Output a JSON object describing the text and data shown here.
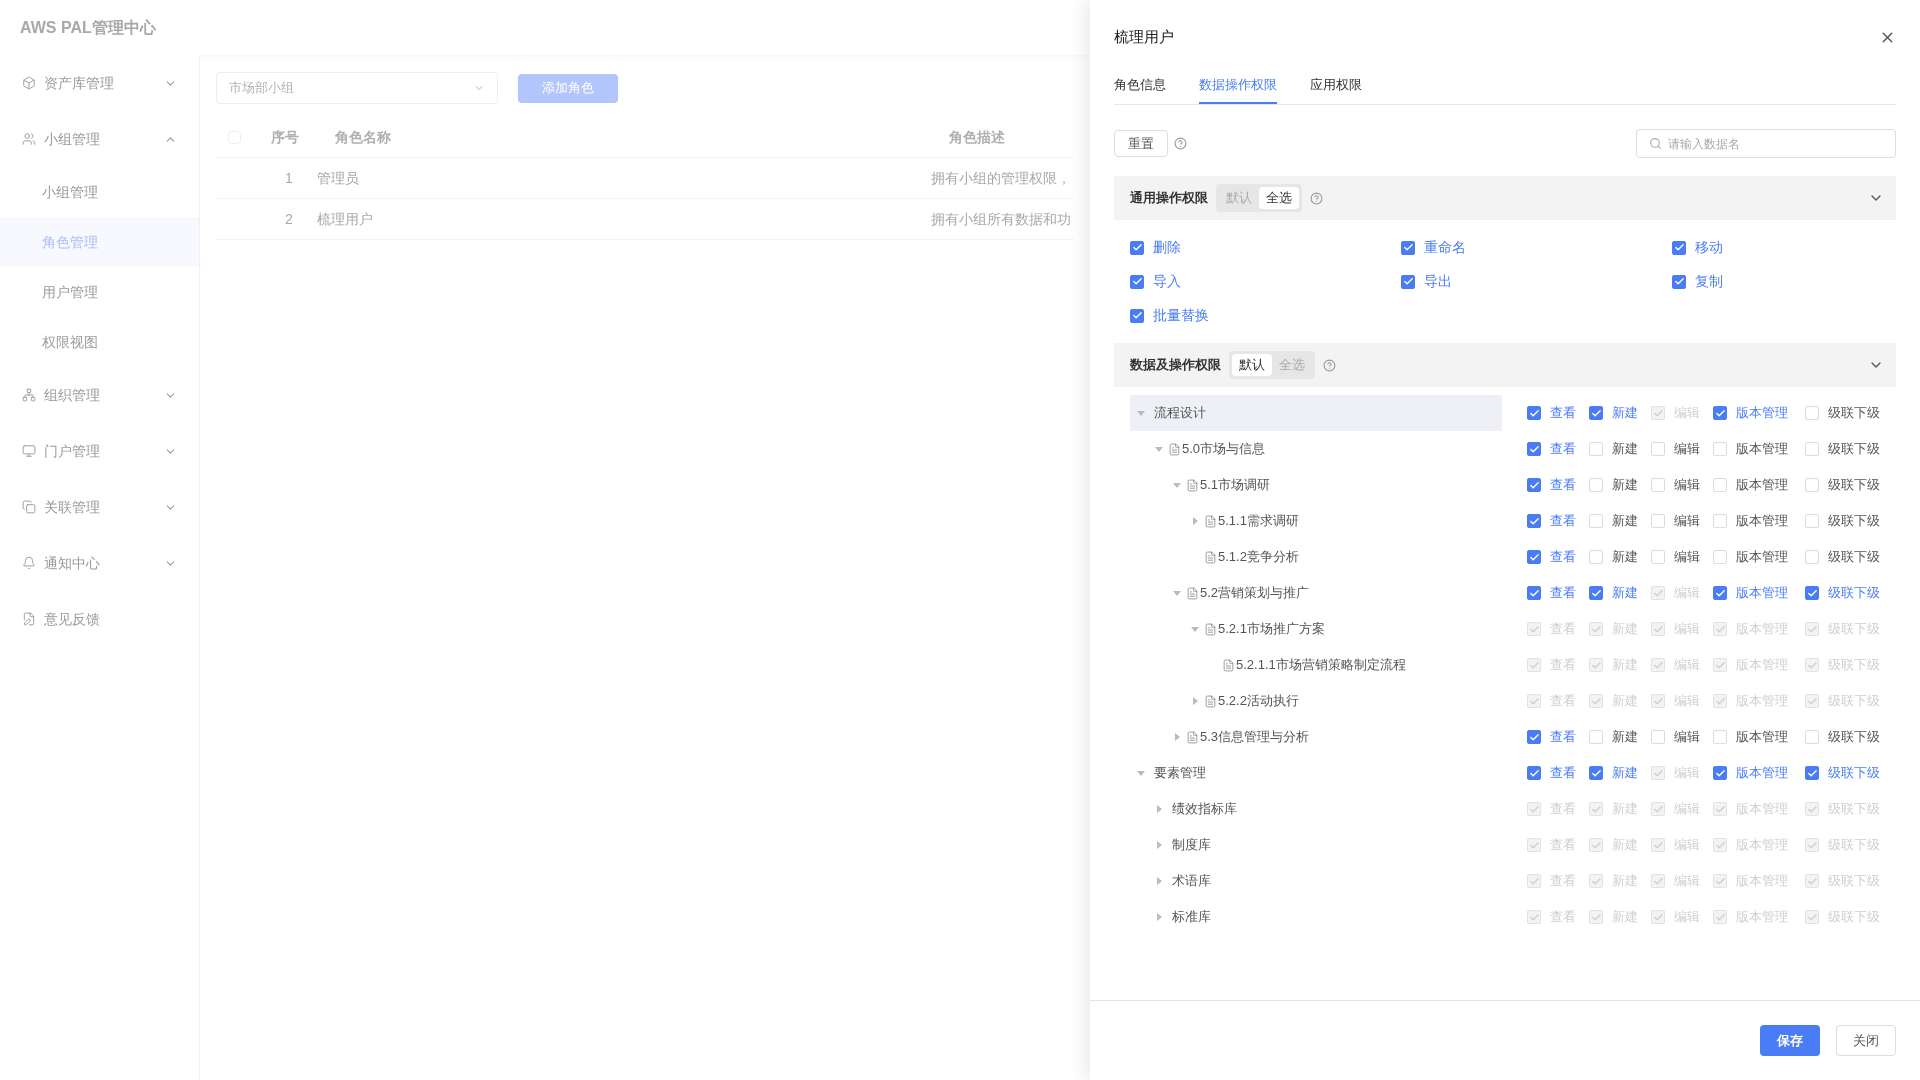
{
  "app": {
    "title": "AWS PAL管理中心"
  },
  "sidebar": {
    "items": [
      {
        "label": "资产库管理",
        "expanded": false,
        "selected": false
      },
      {
        "label": "小组管理",
        "expanded": true,
        "selected": false,
        "children": [
          {
            "label": "小组管理",
            "selected": false
          },
          {
            "label": "角色管理",
            "selected": true
          },
          {
            "label": "用户管理",
            "selected": false
          },
          {
            "label": "权限视图",
            "selected": false
          }
        ]
      },
      {
        "label": "组织管理",
        "expanded": false,
        "selected": false
      },
      {
        "label": "门户管理",
        "expanded": false,
        "selected": false
      },
      {
        "label": "关联管理",
        "expanded": false,
        "selected": false
      },
      {
        "label": "通知中心",
        "expanded": false,
        "selected": false
      },
      {
        "label": "意见反馈",
        "selected": false
      }
    ]
  },
  "toolbar": {
    "group_select": "市场部小组",
    "add_button": "添加角色"
  },
  "table": {
    "all_checked": false,
    "columns": [
      "序号",
      "角色名称",
      "角色描述"
    ],
    "rows": [
      {
        "cells": [
          "1",
          "管理员",
          "拥有小组的管理权限，"
        ]
      },
      {
        "cells": [
          "2",
          "梳理用户",
          "拥有小组所有数据和功"
        ]
      }
    ]
  },
  "drawer": {
    "title": "梳理用户",
    "tabs": [
      {
        "label": "角色信息",
        "selected": false
      },
      {
        "label": "数据操作权限",
        "selected": true
      },
      {
        "label": "应用权限",
        "selected": false
      }
    ],
    "reset_button": "重置",
    "search": {
      "placeholder": "请输入数据名"
    },
    "general": {
      "title": "通用操作权限",
      "modes": [
        {
          "label": "默认",
          "selected": false
        },
        {
          "label": "全选",
          "selected": true
        }
      ],
      "expanded": true,
      "options": [
        {
          "label": "删除",
          "checked": true
        },
        {
          "label": "重命名",
          "checked": true
        },
        {
          "label": "移动",
          "checked": true
        },
        {
          "label": "导入",
          "checked": true
        },
        {
          "label": "导出",
          "checked": true
        },
        {
          "label": "复制",
          "checked": true
        },
        {
          "label": "批量替换",
          "checked": true
        }
      ]
    },
    "data": {
      "title": "数据及操作权限",
      "modes": [
        {
          "label": "默认",
          "selected": true
        },
        {
          "label": "全选",
          "selected": false
        }
      ],
      "expanded": true,
      "tree": [
        {
          "label": "流程设计",
          "kind": "group",
          "expanded": true,
          "selected": true,
          "perms": [
            {
              "label": "查看",
              "checked": true,
              "disabled": false
            },
            {
              "label": "新建",
              "checked": true,
              "disabled": false
            },
            {
              "label": "编辑",
              "checked": true,
              "disabled": true
            },
            {
              "label": "版本管理",
              "checked": true,
              "disabled": false
            },
            {
              "label": "级联下级",
              "checked": false,
              "disabled": false
            }
          ],
          "children": [
            {
              "label": "5.0市场与信息",
              "kind": "doc",
              "expanded": true,
              "selected": false,
              "perms": [
                {
                  "label": "查看",
                  "checked": true,
                  "disabled": false
                },
                {
                  "label": "新建",
                  "checked": false,
                  "disabled": false
                },
                {
                  "label": "编辑",
                  "checked": false,
                  "disabled": false
                },
                {
                  "label": "版本管理",
                  "checked": false,
                  "disabled": false
                },
                {
                  "label": "级联下级",
                  "checked": false,
                  "disabled": false
                }
              ],
              "children": [
                {
                  "label": "5.1市场调研",
                  "kind": "doc",
                  "expanded": true,
                  "selected": false,
                  "perms": [
                    {
                      "label": "查看",
                      "checked": true,
                      "disabled": false
                    },
                    {
                      "label": "新建",
                      "checked": false,
                      "disabled": false
                    },
                    {
                      "label": "编辑",
                      "checked": false,
                      "disabled": false
                    },
                    {
                      "label": "版本管理",
                      "checked": false,
                      "disabled": false
                    },
                    {
                      "label": "级联下级",
                      "checked": false,
                      "disabled": false
                    }
                  ],
                  "children": [
                    {
                      "label": "5.1.1需求调研",
                      "kind": "doc",
                      "expanded": false,
                      "selected": false,
                      "perms": [
                        {
                          "label": "查看",
                          "checked": true,
                          "disabled": false
                        },
                        {
                          "label": "新建",
                          "checked": false,
                          "disabled": false
                        },
                        {
                          "label": "编辑",
                          "checked": false,
                          "disabled": false
                        },
                        {
                          "label": "版本管理",
                          "checked": false,
                          "disabled": false
                        },
                        {
                          "label": "级联下级",
                          "checked": false,
                          "disabled": false
                        }
                      ]
                    },
                    {
                      "label": "5.1.2竞争分析",
                      "kind": "doc",
                      "selected": false,
                      "perms": [
                        {
                          "label": "查看",
                          "checked": true,
                          "disabled": false
                        },
                        {
                          "label": "新建",
                          "checked": false,
                          "disabled": false
                        },
                        {
                          "label": "编辑",
                          "checked": false,
                          "disabled": false
                        },
                        {
                          "label": "版本管理",
                          "checked": false,
                          "disabled": false
                        },
                        {
                          "label": "级联下级",
                          "checked": false,
                          "disabled": false
                        }
                      ]
                    }
                  ]
                },
                {
                  "label": "5.2营销策划与推广",
                  "kind": "doc",
                  "expanded": true,
                  "selected": false,
                  "perms": [
                    {
                      "label": "查看",
                      "checked": true,
                      "disabled": false
                    },
                    {
                      "label": "新建",
                      "checked": true,
                      "disabled": false
                    },
                    {
                      "label": "编辑",
                      "checked": true,
                      "disabled": true
                    },
                    {
                      "label": "版本管理",
                      "checked": true,
                      "disabled": false
                    },
                    {
                      "label": "级联下级",
                      "checked": true,
                      "disabled": false
                    }
                  ],
                  "children": [
                    {
                      "label": "5.2.1市场推广方案",
                      "kind": "doc",
                      "expanded": true,
                      "selected": false,
                      "perms": [
                        {
                          "label": "查看",
                          "checked": true,
                          "disabled": true
                        },
                        {
                          "label": "新建",
                          "checked": true,
                          "disabled": true
                        },
                        {
                          "label": "编辑",
                          "checked": true,
                          "disabled": true
                        },
                        {
                          "label": "版本管理",
                          "checked": true,
                          "disabled": true
                        },
                        {
                          "label": "级联下级",
                          "checked": true,
                          "disabled": true
                        }
                      ],
                      "children": [
                        {
                          "label": "5.2.1.1市场营销策略制定流程",
                          "kind": "doc",
                          "selected": false,
                          "perms": [
                            {
                              "label": "查看",
                              "checked": true,
                              "disabled": true
                            },
                            {
                              "label": "新建",
                              "checked": true,
                              "disabled": true
                            },
                            {
                              "label": "编辑",
                              "checked": true,
                              "disabled": true
                            },
                            {
                              "label": "版本管理",
                              "checked": true,
                              "disabled": true
                            },
                            {
                              "label": "级联下级",
                              "checked": true,
                              "disabled": true
                            }
                          ]
                        }
                      ]
                    },
                    {
                      "label": "5.2.2活动执行",
                      "kind": "doc",
                      "expanded": false,
                      "selected": false,
                      "perms": [
                        {
                          "label": "查看",
                          "checked": true,
                          "disabled": true
                        },
                        {
                          "label": "新建",
                          "checked": true,
                          "disabled": true
                        },
                        {
                          "label": "编辑",
                          "checked": true,
                          "disabled": true
                        },
                        {
                          "label": "版本管理",
                          "checked": true,
                          "disabled": true
                        },
                        {
                          "label": "级联下级",
                          "checked": true,
                          "disabled": true
                        }
                      ]
                    }
                  ]
                },
                {
                  "label": "5.3信息管理与分析",
                  "kind": "doc",
                  "expanded": false,
                  "selected": false,
                  "perms": [
                    {
                      "label": "查看",
                      "checked": true,
                      "disabled": false
                    },
                    {
                      "label": "新建",
                      "checked": false,
                      "disabled": false
                    },
                    {
                      "label": "编辑",
                      "checked": false,
                      "disabled": false
                    },
                    {
                      "label": "版本管理",
                      "checked": false,
                      "disabled": false
                    },
                    {
                      "label": "级联下级",
                      "checked": false,
                      "disabled": false
                    }
                  ]
                }
              ]
            }
          ]
        },
        {
          "label": "要素管理",
          "kind": "group",
          "expanded": true,
          "selected": false,
          "perms": [
            {
              "label": "查看",
              "checked": true,
              "disabled": false
            },
            {
              "label": "新建",
              "checked": true,
              "disabled": false
            },
            {
              "label": "编辑",
              "checked": true,
              "disabled": true
            },
            {
              "label": "版本管理",
              "checked": true,
              "disabled": false
            },
            {
              "label": "级联下级",
              "checked": true,
              "disabled": false
            }
          ],
          "children": [
            {
              "label": "绩效指标库",
              "kind": "group",
              "expanded": false,
              "selected": false,
              "perms": [
                {
                  "label": "查看",
                  "checked": true,
                  "disabled": true
                },
                {
                  "label": "新建",
                  "checked": true,
                  "disabled": true
                },
                {
                  "label": "编辑",
                  "checked": true,
                  "disabled": true
                },
                {
                  "label": "版本管理",
                  "checked": true,
                  "disabled": true
                },
                {
                  "label": "级联下级",
                  "checked": true,
                  "disabled": true
                }
              ]
            },
            {
              "label": "制度库",
              "kind": "group",
              "expanded": false,
              "selected": false,
              "perms": [
                {
                  "label": "查看",
                  "checked": true,
                  "disabled": true
                },
                {
                  "label": "新建",
                  "checked": true,
                  "disabled": true
                },
                {
                  "label": "编辑",
                  "checked": true,
                  "disabled": true
                },
                {
                  "label": "版本管理",
                  "checked": true,
                  "disabled": true
                },
                {
                  "label": "级联下级",
                  "checked": true,
                  "disabled": true
                }
              ]
            },
            {
              "label": "术语库",
              "kind": "group",
              "expanded": false,
              "selected": false,
              "perms": [
                {
                  "label": "查看",
                  "checked": true,
                  "disabled": true
                },
                {
                  "label": "新建",
                  "checked": true,
                  "disabled": true
                },
                {
                  "label": "编辑",
                  "checked": true,
                  "disabled": true
                },
                {
                  "label": "版本管理",
                  "checked": true,
                  "disabled": true
                },
                {
                  "label": "级联下级",
                  "checked": true,
                  "disabled": true
                }
              ]
            },
            {
              "label": "标准库",
              "kind": "group",
              "expanded": false,
              "selected": false,
              "perms": [
                {
                  "label": "查看",
                  "checked": true,
                  "disabled": true
                },
                {
                  "label": "新建",
                  "checked": true,
                  "disabled": true
                },
                {
                  "label": "编辑",
                  "checked": true,
                  "disabled": true
                },
                {
                  "label": "版本管理",
                  "checked": true,
                  "disabled": true
                },
                {
                  "label": "级联下级",
                  "checked": true,
                  "disabled": true
                }
              ]
            }
          ]
        }
      ]
    },
    "footer": {
      "save_button": "保存",
      "close_button": "关闭"
    }
  }
}
